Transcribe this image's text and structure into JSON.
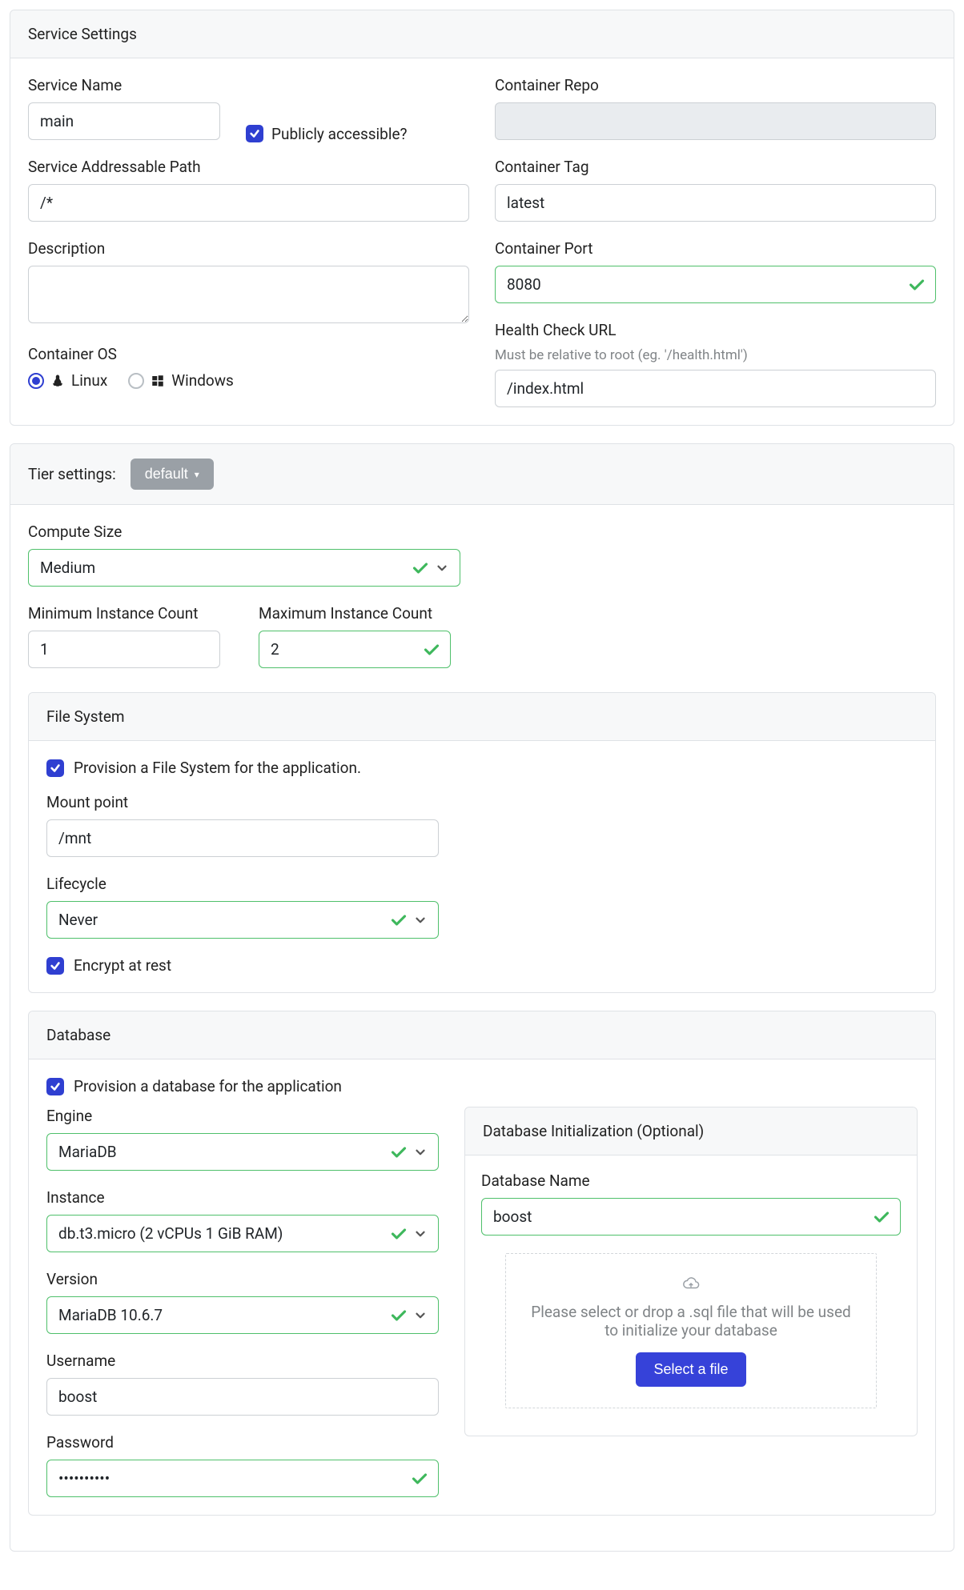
{
  "service": {
    "header": "Service Settings",
    "name_label": "Service Name",
    "name_value": "main",
    "public_label": "Publicly accessible?",
    "public_checked": true,
    "path_label": "Service Addressable Path",
    "path_value": "/*",
    "description_label": "Description",
    "description_value": "",
    "os_label": "Container OS",
    "os_linux": "Linux",
    "os_windows": "Windows",
    "os_selected": "linux",
    "repo_label": "Container Repo",
    "repo_value": "",
    "tag_label": "Container Tag",
    "tag_value": "latest",
    "port_label": "Container Port",
    "port_value": "8080",
    "health_label": "Health Check URL",
    "health_hint": "Must be relative to root (eg. '/health.html')",
    "health_value": "/index.html"
  },
  "tier": {
    "header_label": "Tier settings:",
    "button_label": "default",
    "compute_label": "Compute Size",
    "compute_value": "Medium",
    "min_label": "Minimum Instance Count",
    "min_value": "1",
    "max_label": "Maximum Instance Count",
    "max_value": "2"
  },
  "fs": {
    "header": "File System",
    "provision_label": "Provision a File System for the application.",
    "provision_checked": true,
    "mount_label": "Mount point",
    "mount_value": "/mnt",
    "lifecycle_label": "Lifecycle",
    "lifecycle_value": "Never",
    "encrypt_label": "Encrypt at rest",
    "encrypt_checked": true
  },
  "db": {
    "header": "Database",
    "provision_label": "Provision a database for the application",
    "provision_checked": true,
    "engine_label": "Engine",
    "engine_value": "MariaDB",
    "instance_label": "Instance",
    "instance_value": "db.t3.micro (2 vCPUs 1 GiB RAM)",
    "version_label": "Version",
    "version_value": "MariaDB 10.6.7",
    "username_label": "Username",
    "username_value": "boost",
    "password_label": "Password",
    "password_value": "••••••••••",
    "init_header": "Database Initialization (Optional)",
    "dbname_label": "Database Name",
    "dbname_value": "boost",
    "drop_hint": "Please select or drop a .sql file that will be used to initialize your database",
    "select_file_label": "Select a file"
  }
}
